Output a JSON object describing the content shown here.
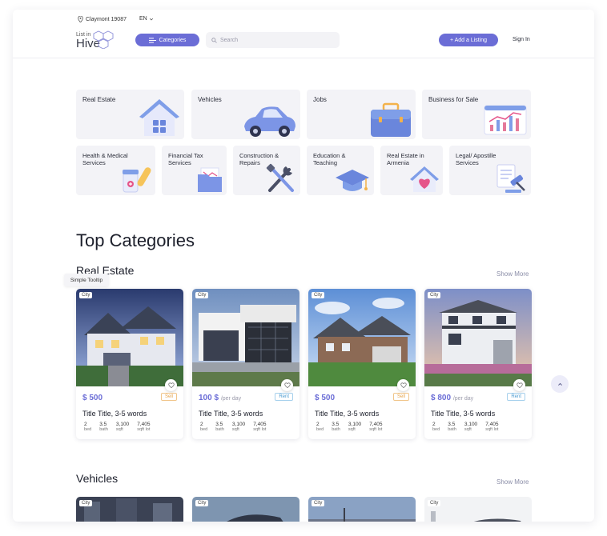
{
  "header": {
    "location": "Claymont 19087",
    "language": "EN",
    "logo_small": "List in",
    "logo_big": "Hive",
    "categories_label": "Categories",
    "search_placeholder": "Search",
    "add_listing_label": "+ Add a Listing",
    "sign_in_label": "Sign In"
  },
  "categories_row1": [
    {
      "label": "Real Estate",
      "icon": "house-icon"
    },
    {
      "label": "Vehicles",
      "icon": "car-icon"
    },
    {
      "label": "Jobs",
      "icon": "briefcase-icon"
    },
    {
      "label": "Business for Sale",
      "icon": "chart-board-icon"
    }
  ],
  "categories_row2": [
    {
      "label": "Health & Medical Services",
      "icon": "medicine-icon"
    },
    {
      "label": "Financial Tax Services",
      "icon": "folder-icon"
    },
    {
      "label": "Construction & Repairs",
      "icon": "tools-icon"
    },
    {
      "label": "Education & Teaching",
      "icon": "graduation-cap-icon"
    },
    {
      "label": "Real Estate in Armenia",
      "icon": "heart-house-icon"
    },
    {
      "label": "Legal/ Apostille Services",
      "icon": "gavel-icon"
    }
  ],
  "top_categories_title": "Top Categories",
  "real_estate_title": "Real Estate",
  "show_more_label": "Show More",
  "tooltip_text": "Simple Tooltip",
  "listings": [
    {
      "chip": "City",
      "price": "$ 500",
      "per": "",
      "tag": "Sell",
      "title": "Title Title, 3-5 words",
      "stats": [
        [
          "2",
          "bed"
        ],
        [
          "3.5",
          "bath"
        ],
        [
          "3,100",
          "sqft"
        ],
        [
          "7,405",
          "sqft lot"
        ]
      ]
    },
    {
      "chip": "City",
      "price": "100 $",
      "per": "/per day",
      "tag": "Rent",
      "title": "Title Title, 3-5 words",
      "stats": [
        [
          "2",
          "bed"
        ],
        [
          "3.5",
          "bath"
        ],
        [
          "3,100",
          "sqft"
        ],
        [
          "7,405",
          "sqft lot"
        ]
      ]
    },
    {
      "chip": "City",
      "price": "$ 500",
      "per": "",
      "tag": "Sell",
      "title": "Title Title, 3-5 words",
      "stats": [
        [
          "2",
          "bed"
        ],
        [
          "3.5",
          "bath"
        ],
        [
          "3,100",
          "sqft"
        ],
        [
          "7,405",
          "sqft lot"
        ]
      ]
    },
    {
      "chip": "City",
      "price": "$ 800",
      "per": "/per day",
      "tag": "Rent",
      "title": "Title Title, 3-5 words",
      "stats": [
        [
          "2",
          "bed"
        ],
        [
          "3.5",
          "bath"
        ],
        [
          "3,100",
          "sqft"
        ],
        [
          "7,405",
          "sqft lot"
        ]
      ]
    }
  ],
  "vehicles_title": "Vehicles",
  "vehicle_chips": [
    "City",
    "City",
    "City",
    "City"
  ],
  "colors": {
    "accent": "#6b6dd6",
    "sell": "#e6a34a",
    "rent": "#4a9ad0"
  }
}
